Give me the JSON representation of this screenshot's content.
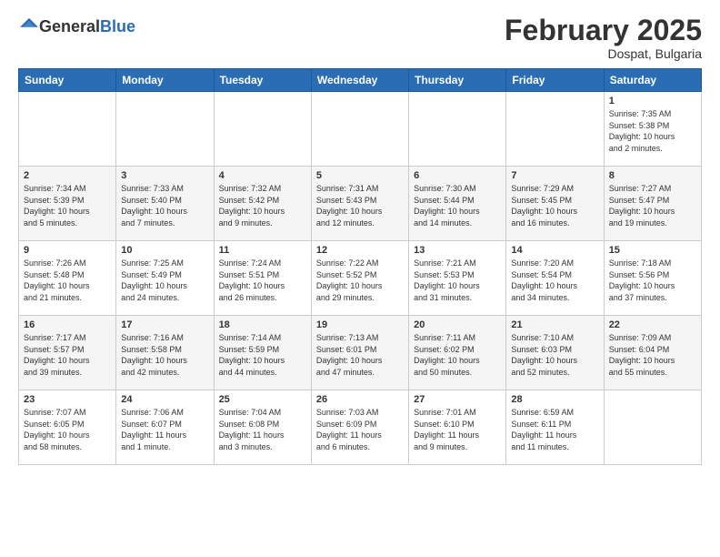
{
  "logo": {
    "general": "General",
    "blue": "Blue"
  },
  "header": {
    "month": "February 2025",
    "location": "Dospat, Bulgaria"
  },
  "weekdays": [
    "Sunday",
    "Monday",
    "Tuesday",
    "Wednesday",
    "Thursday",
    "Friday",
    "Saturday"
  ],
  "weeks": [
    [
      {
        "day": "",
        "info": ""
      },
      {
        "day": "",
        "info": ""
      },
      {
        "day": "",
        "info": ""
      },
      {
        "day": "",
        "info": ""
      },
      {
        "day": "",
        "info": ""
      },
      {
        "day": "",
        "info": ""
      },
      {
        "day": "1",
        "info": "Sunrise: 7:35 AM\nSunset: 5:38 PM\nDaylight: 10 hours\nand 2 minutes."
      }
    ],
    [
      {
        "day": "2",
        "info": "Sunrise: 7:34 AM\nSunset: 5:39 PM\nDaylight: 10 hours\nand 5 minutes."
      },
      {
        "day": "3",
        "info": "Sunrise: 7:33 AM\nSunset: 5:40 PM\nDaylight: 10 hours\nand 7 minutes."
      },
      {
        "day": "4",
        "info": "Sunrise: 7:32 AM\nSunset: 5:42 PM\nDaylight: 10 hours\nand 9 minutes."
      },
      {
        "day": "5",
        "info": "Sunrise: 7:31 AM\nSunset: 5:43 PM\nDaylight: 10 hours\nand 12 minutes."
      },
      {
        "day": "6",
        "info": "Sunrise: 7:30 AM\nSunset: 5:44 PM\nDaylight: 10 hours\nand 14 minutes."
      },
      {
        "day": "7",
        "info": "Sunrise: 7:29 AM\nSunset: 5:45 PM\nDaylight: 10 hours\nand 16 minutes."
      },
      {
        "day": "8",
        "info": "Sunrise: 7:27 AM\nSunset: 5:47 PM\nDaylight: 10 hours\nand 19 minutes."
      }
    ],
    [
      {
        "day": "9",
        "info": "Sunrise: 7:26 AM\nSunset: 5:48 PM\nDaylight: 10 hours\nand 21 minutes."
      },
      {
        "day": "10",
        "info": "Sunrise: 7:25 AM\nSunset: 5:49 PM\nDaylight: 10 hours\nand 24 minutes."
      },
      {
        "day": "11",
        "info": "Sunrise: 7:24 AM\nSunset: 5:51 PM\nDaylight: 10 hours\nand 26 minutes."
      },
      {
        "day": "12",
        "info": "Sunrise: 7:22 AM\nSunset: 5:52 PM\nDaylight: 10 hours\nand 29 minutes."
      },
      {
        "day": "13",
        "info": "Sunrise: 7:21 AM\nSunset: 5:53 PM\nDaylight: 10 hours\nand 31 minutes."
      },
      {
        "day": "14",
        "info": "Sunrise: 7:20 AM\nSunset: 5:54 PM\nDaylight: 10 hours\nand 34 minutes."
      },
      {
        "day": "15",
        "info": "Sunrise: 7:18 AM\nSunset: 5:56 PM\nDaylight: 10 hours\nand 37 minutes."
      }
    ],
    [
      {
        "day": "16",
        "info": "Sunrise: 7:17 AM\nSunset: 5:57 PM\nDaylight: 10 hours\nand 39 minutes."
      },
      {
        "day": "17",
        "info": "Sunrise: 7:16 AM\nSunset: 5:58 PM\nDaylight: 10 hours\nand 42 minutes."
      },
      {
        "day": "18",
        "info": "Sunrise: 7:14 AM\nSunset: 5:59 PM\nDaylight: 10 hours\nand 44 minutes."
      },
      {
        "day": "19",
        "info": "Sunrise: 7:13 AM\nSunset: 6:01 PM\nDaylight: 10 hours\nand 47 minutes."
      },
      {
        "day": "20",
        "info": "Sunrise: 7:11 AM\nSunset: 6:02 PM\nDaylight: 10 hours\nand 50 minutes."
      },
      {
        "day": "21",
        "info": "Sunrise: 7:10 AM\nSunset: 6:03 PM\nDaylight: 10 hours\nand 52 minutes."
      },
      {
        "day": "22",
        "info": "Sunrise: 7:09 AM\nSunset: 6:04 PM\nDaylight: 10 hours\nand 55 minutes."
      }
    ],
    [
      {
        "day": "23",
        "info": "Sunrise: 7:07 AM\nSunset: 6:05 PM\nDaylight: 10 hours\nand 58 minutes."
      },
      {
        "day": "24",
        "info": "Sunrise: 7:06 AM\nSunset: 6:07 PM\nDaylight: 11 hours\nand 1 minute."
      },
      {
        "day": "25",
        "info": "Sunrise: 7:04 AM\nSunset: 6:08 PM\nDaylight: 11 hours\nand 3 minutes."
      },
      {
        "day": "26",
        "info": "Sunrise: 7:03 AM\nSunset: 6:09 PM\nDaylight: 11 hours\nand 6 minutes."
      },
      {
        "day": "27",
        "info": "Sunrise: 7:01 AM\nSunset: 6:10 PM\nDaylight: 11 hours\nand 9 minutes."
      },
      {
        "day": "28",
        "info": "Sunrise: 6:59 AM\nSunset: 6:11 PM\nDaylight: 11 hours\nand 11 minutes."
      },
      {
        "day": "",
        "info": ""
      }
    ]
  ]
}
